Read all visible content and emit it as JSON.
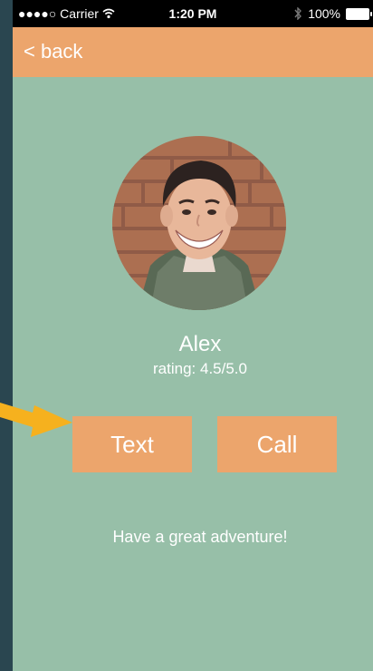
{
  "status_bar": {
    "carrier": "●●●●○ Carrier",
    "time": "1:20 PM",
    "battery": "100%"
  },
  "nav": {
    "back_label": "< back"
  },
  "profile": {
    "name": "Alex",
    "rating": "rating: 4.5/5.0"
  },
  "actions": {
    "text_label": "Text",
    "call_label": "Call"
  },
  "message": "Have a great adventure!",
  "colors": {
    "background": "#97bfa8",
    "accent": "#eca56c",
    "sidebar": "#2a4650",
    "annotation_arrow": "#f6b11e"
  }
}
